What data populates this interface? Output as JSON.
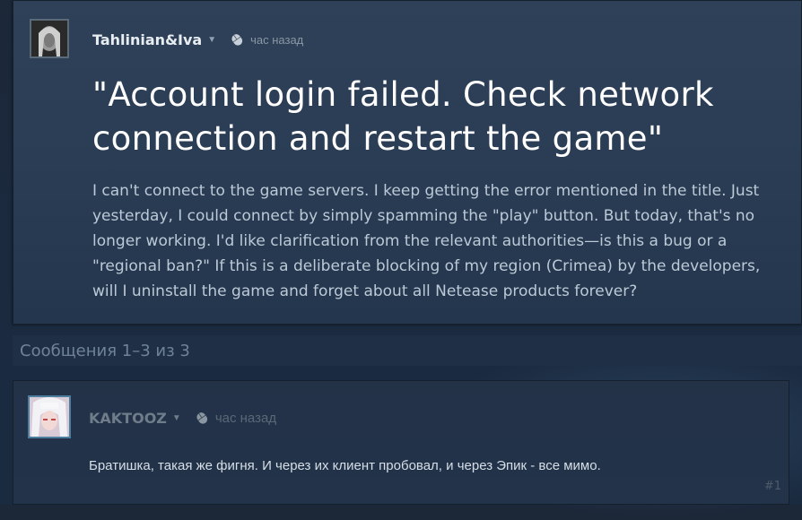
{
  "topic": {
    "author": "Tahlinian&Iva",
    "time": "час назад",
    "title": "\"Account login failed. Check network connection and restart the game\"",
    "body": "I can't connect to the game servers. I keep getting the error mentioned in the title. Just yesterday, I could connect by simply spamming the \"play\" button. But today, that's no longer working. I'd like clarification from the relevant authorities—is this a bug or a \"regional ban?\" If this is a deliberate blocking of my region (Crimea) by the developers, will I uninstall the game and forget about all Netease products forever?"
  },
  "messages": {
    "count_label": "Сообщения 1–3 из 3"
  },
  "reply": {
    "author": "KAKTOOZ",
    "time": "час назад",
    "body": "Братишка, такая же фигня. И через их клиент пробовал, и через Эпик - все мимо.",
    "post_number": "#1"
  },
  "icons": {
    "author_dropdown": "chevron-down-icon",
    "time": "mouse-icon"
  },
  "colors": {
    "panel": "#2f4158",
    "title": "#ffffff",
    "body_text": "#bcc9d6",
    "muted": "#8a97a4"
  }
}
